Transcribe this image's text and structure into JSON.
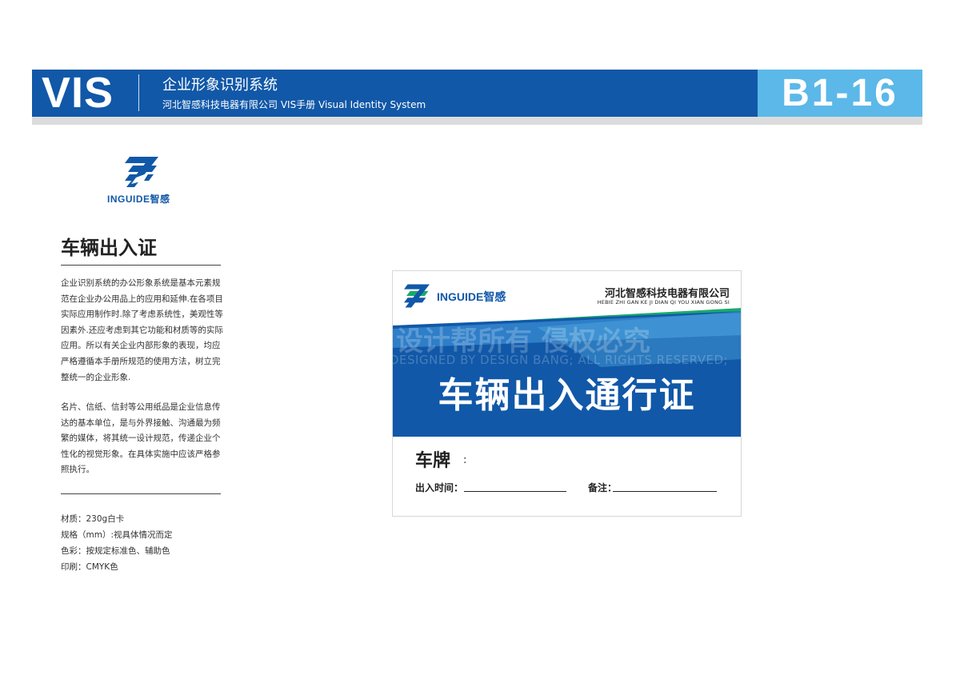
{
  "header": {
    "vis": "VIS",
    "title": "企业形象识别系统",
    "subtitle": "河北智感科技电器有限公司 VIS手册    Visual Identity System",
    "page_code": "B1-16"
  },
  "brand": {
    "name_en": "INGUIDE",
    "name_cn": "智感"
  },
  "section": {
    "title": "车辆出入证",
    "paragraph1": "企业识别系统的办公形象系统是基本元素规范在企业办公用品上的应用和延伸.在各项目实际应用制作时.除了考虑系统性，美观性等因素外.还应考虑到其它功能和材质等的实际应用。所以有关企业内部形象的表现，均应严格遵循本手册所规范的使用方法，树立完整统一的企业形象.",
    "paragraph2": "名片、信纸、信封等公用纸品是企业信息传达的基本单位，是与外界接触、沟通最为频繁的媒体，将其统一设计规范，传递企业个性化的视觉形象。在具体实施中应该严格参照执行。"
  },
  "specs": [
    "材质：230g白卡",
    "规格（mm）:视具体情况而定",
    "色彩：按规定标准色、辅助色",
    "印刷：CMYK色"
  ],
  "card": {
    "company_cn": "河北智感科技电器有限公司",
    "company_en": "HEBIE ZHI GAN KE JI DIAN QI YOU XIAN GONG SI",
    "title": "车辆出入通行证",
    "watermark_cn": "设计帮所有  侵权必究",
    "watermark_en": "DESIGNED BY DESIGN BANG; ALL RIGHTS RESERVED;",
    "plate_label": "车牌",
    "plate_colon": ":",
    "time_label": "出入时间：",
    "note_label": "备注："
  },
  "colors": {
    "primary_blue": "#1158a8",
    "light_blue": "#5bb8e8",
    "green": "#1aaa6a"
  }
}
